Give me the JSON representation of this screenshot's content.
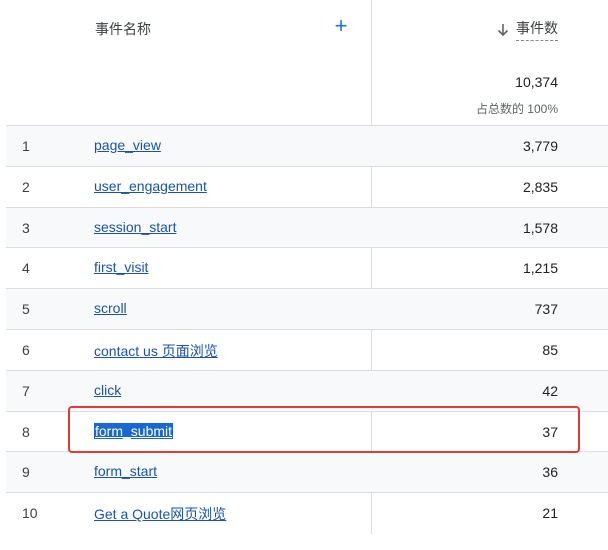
{
  "header": {
    "event_name_label": "事件名称",
    "add_label": "+",
    "event_count_label": "事件数",
    "total": "10,374",
    "total_sub": "占总数的 100%"
  },
  "rows": [
    {
      "index": "1",
      "name": "page_view",
      "value": "3,779"
    },
    {
      "index": "2",
      "name": "user_engagement",
      "value": "2,835"
    },
    {
      "index": "3",
      "name": "session_start",
      "value": "1,578"
    },
    {
      "index": "4",
      "name": "first_visit",
      "value": "1,215"
    },
    {
      "index": "5",
      "name": "scroll",
      "value": "737"
    },
    {
      "index": "6",
      "name": "contact us 页面浏览",
      "value": "85"
    },
    {
      "index": "7",
      "name": "click",
      "value": "42"
    },
    {
      "index": "8",
      "name": "form_submit",
      "value": "37"
    },
    {
      "index": "9",
      "name": "form_start",
      "value": "36"
    },
    {
      "index": "10",
      "name": "Get a Quote网页浏览",
      "value": "21"
    }
  ],
  "colors": {
    "link": "#1a53ad",
    "accent": "#1a73e8",
    "highlight_box": "#e53935",
    "selection": "#1967d2"
  },
  "icons": {
    "sort": "arrow-down-icon",
    "add": "plus-icon"
  }
}
